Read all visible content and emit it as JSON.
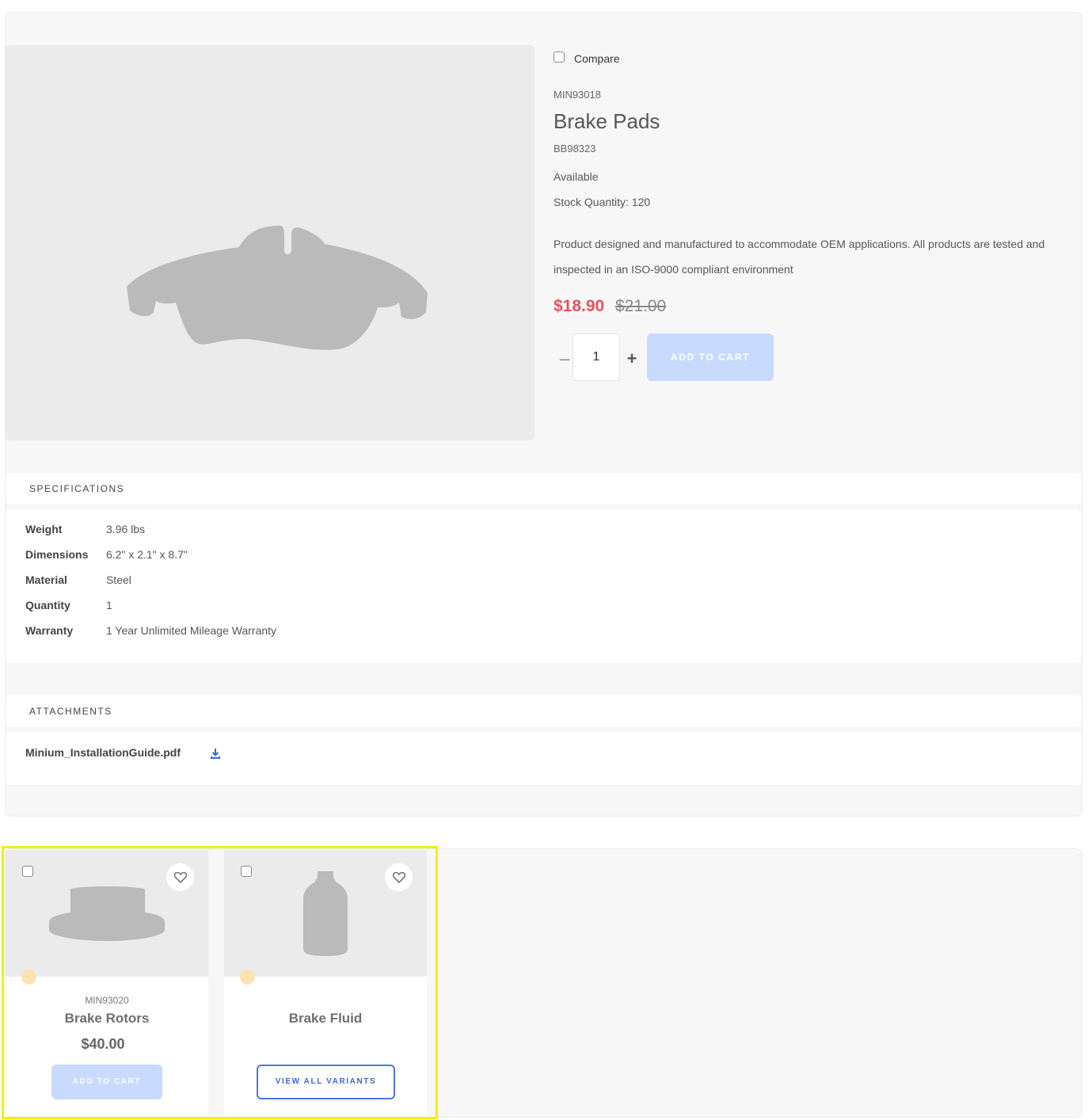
{
  "product": {
    "compare_label": "Compare",
    "sku": "MIN93018",
    "title": "Brake Pads",
    "part_number": "BB98323",
    "availability": "Available",
    "stock": "Stock Quantity: 120",
    "description": "Product designed and manufactured to accommodate OEM applications. All products are tested and inspected in an ISO-9000 compliant environment",
    "price": "$18.90",
    "old_price": "$21.00",
    "quantity": "1",
    "add_to_cart": "ADD TO CART",
    "image_icon": "brake-pad-silhouette"
  },
  "specifications": {
    "heading": "SPECIFICATIONS",
    "rows": [
      {
        "key": "Weight",
        "value": "3.96 lbs"
      },
      {
        "key": "Dimensions",
        "value": "6.2\" x 2.1\" x 8.7\""
      },
      {
        "key": "Material",
        "value": "Steel"
      },
      {
        "key": "Quantity",
        "value": "1"
      },
      {
        "key": "Warranty",
        "value": "1 Year Unlimited Mileage Warranty"
      }
    ]
  },
  "attachments": {
    "heading": "ATTACHMENTS",
    "file_name": "Minium_InstallationGuide.pdf",
    "icon": "download-icon"
  },
  "related": [
    {
      "sku": "MIN93020",
      "title": "Brake Rotors",
      "price": "$40.00",
      "button": "ADD TO CART",
      "image_icon": "brake-rotor-silhouette"
    },
    {
      "sku": "",
      "title": "Brake Fluid",
      "price": "",
      "button": "VIEW ALL VARIANTS",
      "image_icon": "bottle-silhouette"
    }
  ],
  "colors": {
    "sale_price": "#e8525f",
    "button_disabled": "#c8dbff",
    "variants_border": "#4a78e0",
    "highlight": "#f3ef13"
  }
}
